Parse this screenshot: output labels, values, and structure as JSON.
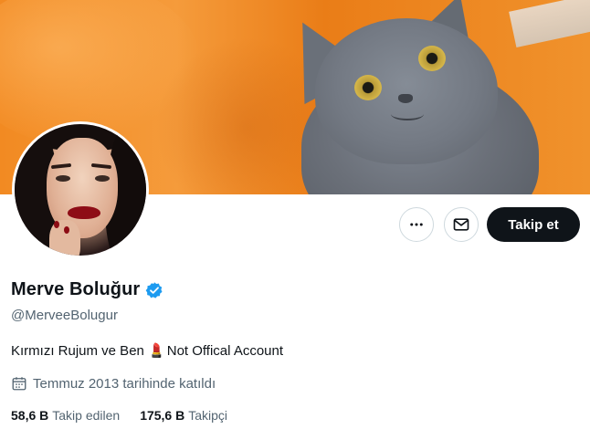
{
  "profile": {
    "name": "Merve Boluğur",
    "handle": "@MerveeBolugur",
    "verified": true,
    "bio_prefix": "Kırmızı Rujum ve Ben ",
    "bio_emoji": "💄",
    "bio_suffix": "Not Offical Account",
    "joined": "Temmuz 2013 tarihinde katıldı",
    "following_count": "58,6 B",
    "following_label": "Takip edilen",
    "followers_count": "175,6 B",
    "followers_label": "Takipçi"
  },
  "actions": {
    "more_icon": "more-horizontal-icon",
    "message_icon": "envelope-icon",
    "follow_label": "Takip et"
  },
  "colors": {
    "verified_badge": "#1d9bf0",
    "follow_button_bg": "#0f1419",
    "secondary_text": "#536471",
    "banner_orange": "#f28a22"
  }
}
